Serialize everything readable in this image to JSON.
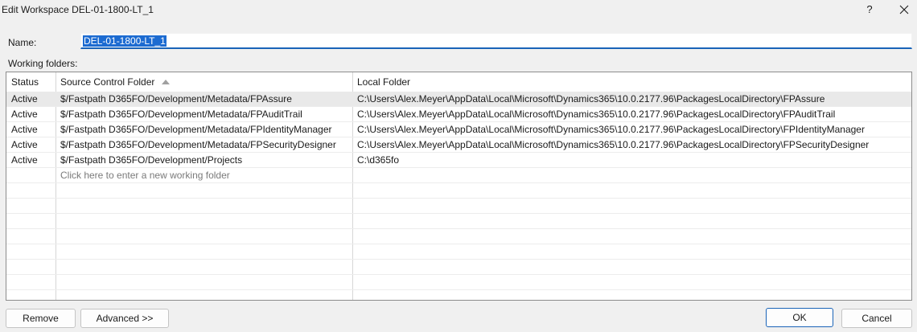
{
  "window": {
    "title": "Edit Workspace DEL-01-1800-LT_1",
    "help_label": "?"
  },
  "form": {
    "name_label": "Name:",
    "name_value": "DEL-01-1800-LT_1",
    "working_folders_label": "Working folders:"
  },
  "grid": {
    "columns": [
      "Status",
      "Source Control Folder",
      "Local Folder"
    ],
    "sorted_column": "Source Control Folder",
    "sort_direction": "ascending",
    "rows": [
      {
        "status": "Active",
        "source": "$/Fastpath D365FO/Development/Metadata/FPAssure",
        "local": "C:\\Users\\Alex.Meyer\\AppData\\Local\\Microsoft\\Dynamics365\\10.0.2177.96\\PackagesLocalDirectory\\FPAssure"
      },
      {
        "status": "Active",
        "source": "$/Fastpath D365FO/Development/Metadata/FPAuditTrail",
        "local": "C:\\Users\\Alex.Meyer\\AppData\\Local\\Microsoft\\Dynamics365\\10.0.2177.96\\PackagesLocalDirectory\\FPAuditTrail"
      },
      {
        "status": "Active",
        "source": "$/Fastpath D365FO/Development/Metadata/FPIdentityManager",
        "local": "C:\\Users\\Alex.Meyer\\AppData\\Local\\Microsoft\\Dynamics365\\10.0.2177.96\\PackagesLocalDirectory\\FPIdentityManager"
      },
      {
        "status": "Active",
        "source": "$/Fastpath D365FO/Development/Metadata/FPSecurityDesigner",
        "local": "C:\\Users\\Alex.Meyer\\AppData\\Local\\Microsoft\\Dynamics365\\10.0.2177.96\\PackagesLocalDirectory\\FPSecurityDesigner"
      },
      {
        "status": "Active",
        "source": "$/Fastpath D365FO/Development/Projects",
        "local": "C:\\d365fo"
      }
    ],
    "new_row_placeholder": "Click here to enter a new working folder"
  },
  "buttons": {
    "remove": "Remove",
    "advanced": "Advanced >>",
    "ok": "OK",
    "cancel": "Cancel"
  },
  "colors": {
    "accent": "#1a64b8",
    "selection": "#1c6bd1"
  },
  "icons": {
    "close": "close-icon",
    "sort": "sort-ascending-icon"
  }
}
